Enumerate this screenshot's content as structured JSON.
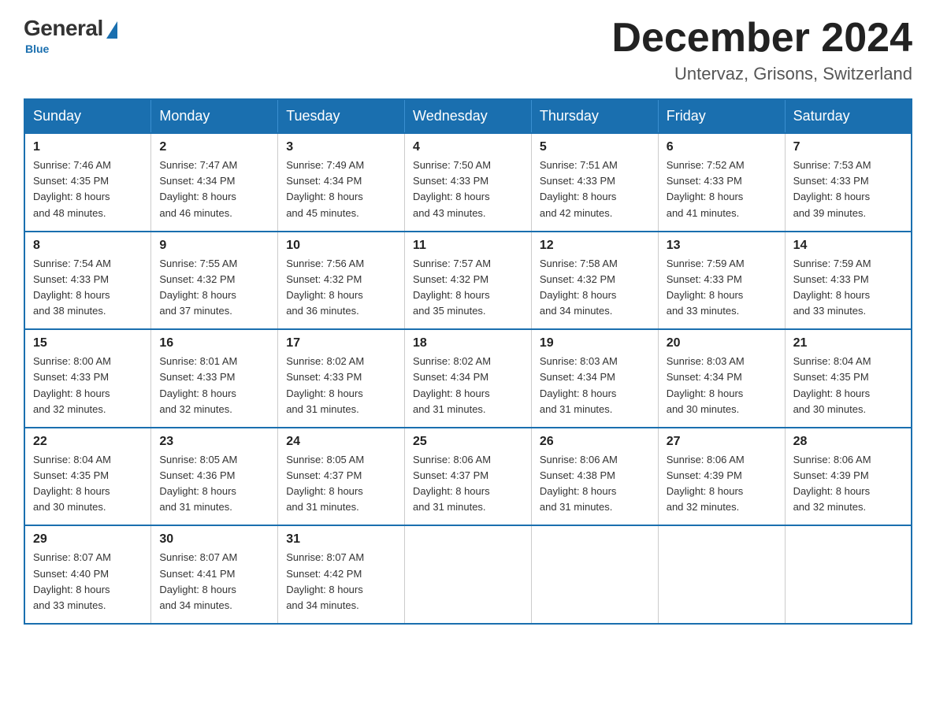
{
  "logo": {
    "general": "General",
    "blue": "Blue"
  },
  "title": {
    "month": "December 2024",
    "location": "Untervaz, Grisons, Switzerland"
  },
  "headers": [
    "Sunday",
    "Monday",
    "Tuesday",
    "Wednesday",
    "Thursday",
    "Friday",
    "Saturday"
  ],
  "weeks": [
    [
      {
        "day": "1",
        "sunrise": "7:46 AM",
        "sunset": "4:35 PM",
        "daylight": "8 hours and 48 minutes."
      },
      {
        "day": "2",
        "sunrise": "7:47 AM",
        "sunset": "4:34 PM",
        "daylight": "8 hours and 46 minutes."
      },
      {
        "day": "3",
        "sunrise": "7:49 AM",
        "sunset": "4:34 PM",
        "daylight": "8 hours and 45 minutes."
      },
      {
        "day": "4",
        "sunrise": "7:50 AM",
        "sunset": "4:33 PM",
        "daylight": "8 hours and 43 minutes."
      },
      {
        "day": "5",
        "sunrise": "7:51 AM",
        "sunset": "4:33 PM",
        "daylight": "8 hours and 42 minutes."
      },
      {
        "day": "6",
        "sunrise": "7:52 AM",
        "sunset": "4:33 PM",
        "daylight": "8 hours and 41 minutes."
      },
      {
        "day": "7",
        "sunrise": "7:53 AM",
        "sunset": "4:33 PM",
        "daylight": "8 hours and 39 minutes."
      }
    ],
    [
      {
        "day": "8",
        "sunrise": "7:54 AM",
        "sunset": "4:33 PM",
        "daylight": "8 hours and 38 minutes."
      },
      {
        "day": "9",
        "sunrise": "7:55 AM",
        "sunset": "4:32 PM",
        "daylight": "8 hours and 37 minutes."
      },
      {
        "day": "10",
        "sunrise": "7:56 AM",
        "sunset": "4:32 PM",
        "daylight": "8 hours and 36 minutes."
      },
      {
        "day": "11",
        "sunrise": "7:57 AM",
        "sunset": "4:32 PM",
        "daylight": "8 hours and 35 minutes."
      },
      {
        "day": "12",
        "sunrise": "7:58 AM",
        "sunset": "4:32 PM",
        "daylight": "8 hours and 34 minutes."
      },
      {
        "day": "13",
        "sunrise": "7:59 AM",
        "sunset": "4:33 PM",
        "daylight": "8 hours and 33 minutes."
      },
      {
        "day": "14",
        "sunrise": "7:59 AM",
        "sunset": "4:33 PM",
        "daylight": "8 hours and 33 minutes."
      }
    ],
    [
      {
        "day": "15",
        "sunrise": "8:00 AM",
        "sunset": "4:33 PM",
        "daylight": "8 hours and 32 minutes."
      },
      {
        "day": "16",
        "sunrise": "8:01 AM",
        "sunset": "4:33 PM",
        "daylight": "8 hours and 32 minutes."
      },
      {
        "day": "17",
        "sunrise": "8:02 AM",
        "sunset": "4:33 PM",
        "daylight": "8 hours and 31 minutes."
      },
      {
        "day": "18",
        "sunrise": "8:02 AM",
        "sunset": "4:34 PM",
        "daylight": "8 hours and 31 minutes."
      },
      {
        "day": "19",
        "sunrise": "8:03 AM",
        "sunset": "4:34 PM",
        "daylight": "8 hours and 31 minutes."
      },
      {
        "day": "20",
        "sunrise": "8:03 AM",
        "sunset": "4:34 PM",
        "daylight": "8 hours and 30 minutes."
      },
      {
        "day": "21",
        "sunrise": "8:04 AM",
        "sunset": "4:35 PM",
        "daylight": "8 hours and 30 minutes."
      }
    ],
    [
      {
        "day": "22",
        "sunrise": "8:04 AM",
        "sunset": "4:35 PM",
        "daylight": "8 hours and 30 minutes."
      },
      {
        "day": "23",
        "sunrise": "8:05 AM",
        "sunset": "4:36 PM",
        "daylight": "8 hours and 31 minutes."
      },
      {
        "day": "24",
        "sunrise": "8:05 AM",
        "sunset": "4:37 PM",
        "daylight": "8 hours and 31 minutes."
      },
      {
        "day": "25",
        "sunrise": "8:06 AM",
        "sunset": "4:37 PM",
        "daylight": "8 hours and 31 minutes."
      },
      {
        "day": "26",
        "sunrise": "8:06 AM",
        "sunset": "4:38 PM",
        "daylight": "8 hours and 31 minutes."
      },
      {
        "day": "27",
        "sunrise": "8:06 AM",
        "sunset": "4:39 PM",
        "daylight": "8 hours and 32 minutes."
      },
      {
        "day": "28",
        "sunrise": "8:06 AM",
        "sunset": "4:39 PM",
        "daylight": "8 hours and 32 minutes."
      }
    ],
    [
      {
        "day": "29",
        "sunrise": "8:07 AM",
        "sunset": "4:40 PM",
        "daylight": "8 hours and 33 minutes."
      },
      {
        "day": "30",
        "sunrise": "8:07 AM",
        "sunset": "4:41 PM",
        "daylight": "8 hours and 34 minutes."
      },
      {
        "day": "31",
        "sunrise": "8:07 AM",
        "sunset": "4:42 PM",
        "daylight": "8 hours and 34 minutes."
      },
      null,
      null,
      null,
      null
    ]
  ],
  "labels": {
    "sunrise": "Sunrise:",
    "sunset": "Sunset:",
    "daylight": "Daylight:"
  }
}
